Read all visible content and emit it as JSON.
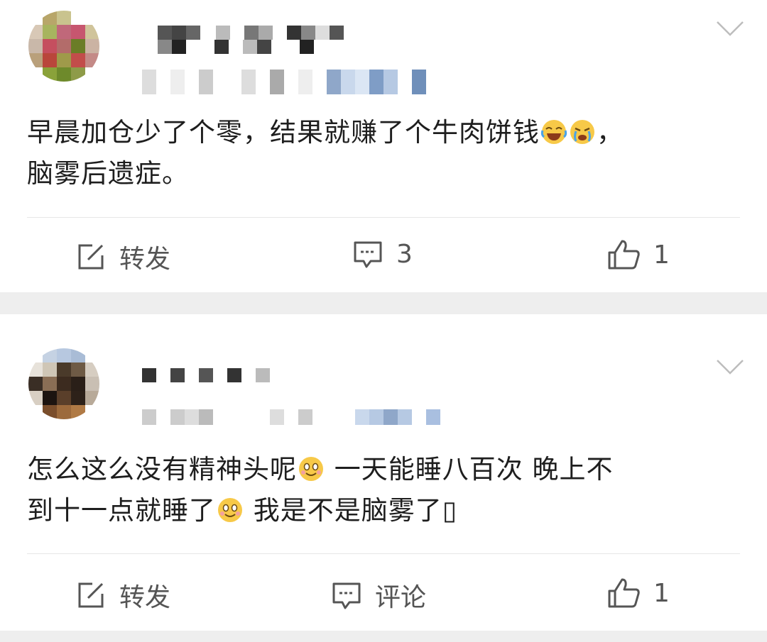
{
  "posts": [
    {
      "content_line1": "早晨加仓少了个零，结果就赚了个牛肉饼钱",
      "content_after_emoji": "，",
      "content_line2": "脑雾后遗症。",
      "emojis": [
        "laughing-tears-emoji",
        "crying-emoji"
      ],
      "actions": {
        "repost_label": "转发",
        "comment_label": "3",
        "like_count": "1"
      }
    },
    {
      "content_line1_a": "怎么这么没有精神头呢",
      "content_line1_b": " 一天能睡八百次 晚上不",
      "content_line2_a": "到十一点就睡了",
      "content_line2_b": " 我是不是脑雾了",
      "content_tail_glyph": "▯",
      "emojis": [
        "smile-emoji",
        "smile-emoji"
      ],
      "actions": {
        "repost_label": "转发",
        "comment_label": "评论",
        "like_count": "1"
      }
    }
  ],
  "icons": {
    "more": "chevron-down-icon",
    "repost": "repost-icon",
    "comment": "comment-icon",
    "like": "thumbs-up-icon"
  },
  "colors": {
    "background": "#eeeeee",
    "card": "#ffffff",
    "text": "#1e1e1e",
    "icon": "#555555",
    "divider": "#e6e6e6"
  }
}
